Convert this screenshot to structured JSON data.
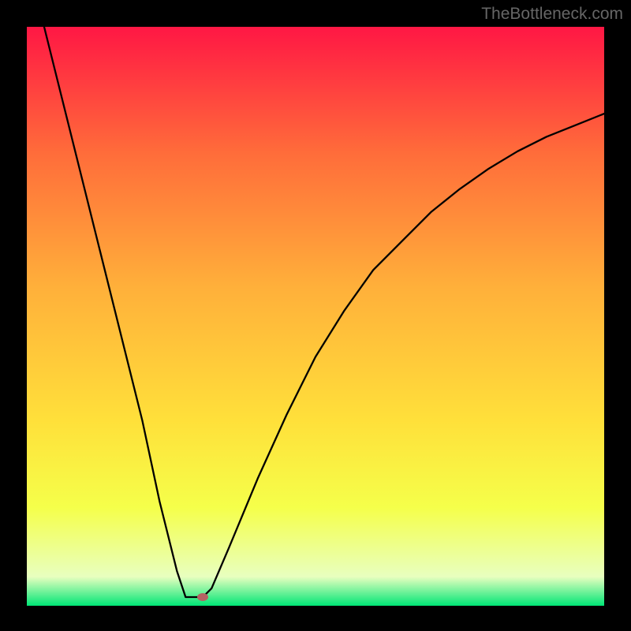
{
  "watermark": "TheBottleneck.com",
  "chart_data": {
    "type": "line",
    "title": "",
    "xlabel": "",
    "ylabel": "",
    "x_range": [
      0,
      100
    ],
    "y_range": [
      0,
      100
    ],
    "curve_points": [
      {
        "x": 3,
        "y": 100
      },
      {
        "x": 5,
        "y": 92
      },
      {
        "x": 10,
        "y": 72
      },
      {
        "x": 15,
        "y": 52
      },
      {
        "x": 20,
        "y": 32
      },
      {
        "x": 23,
        "y": 18
      },
      {
        "x": 26,
        "y": 6
      },
      {
        "x": 27.5,
        "y": 1.5
      },
      {
        "x": 30.5,
        "y": 1.5
      },
      {
        "x": 32,
        "y": 3
      },
      {
        "x": 35,
        "y": 10
      },
      {
        "x": 40,
        "y": 22
      },
      {
        "x": 45,
        "y": 33
      },
      {
        "x": 50,
        "y": 43
      },
      {
        "x": 55,
        "y": 51
      },
      {
        "x": 60,
        "y": 58
      },
      {
        "x": 65,
        "y": 63
      },
      {
        "x": 70,
        "y": 68
      },
      {
        "x": 75,
        "y": 72
      },
      {
        "x": 80,
        "y": 75.5
      },
      {
        "x": 85,
        "y": 78.5
      },
      {
        "x": 90,
        "y": 81
      },
      {
        "x": 95,
        "y": 83
      },
      {
        "x": 100,
        "y": 85
      }
    ],
    "marker": {
      "x": 30.5,
      "y": 1.5,
      "color": "#b56363"
    },
    "gradient": {
      "top": "#ff1744",
      "upper_mid": "#ff6d3a",
      "mid": "#ffb03a",
      "lower_mid": "#ffe03a",
      "lower": "#f5ff4a",
      "near_bottom": "#e8ffbf",
      "bottom": "#00e676"
    }
  }
}
